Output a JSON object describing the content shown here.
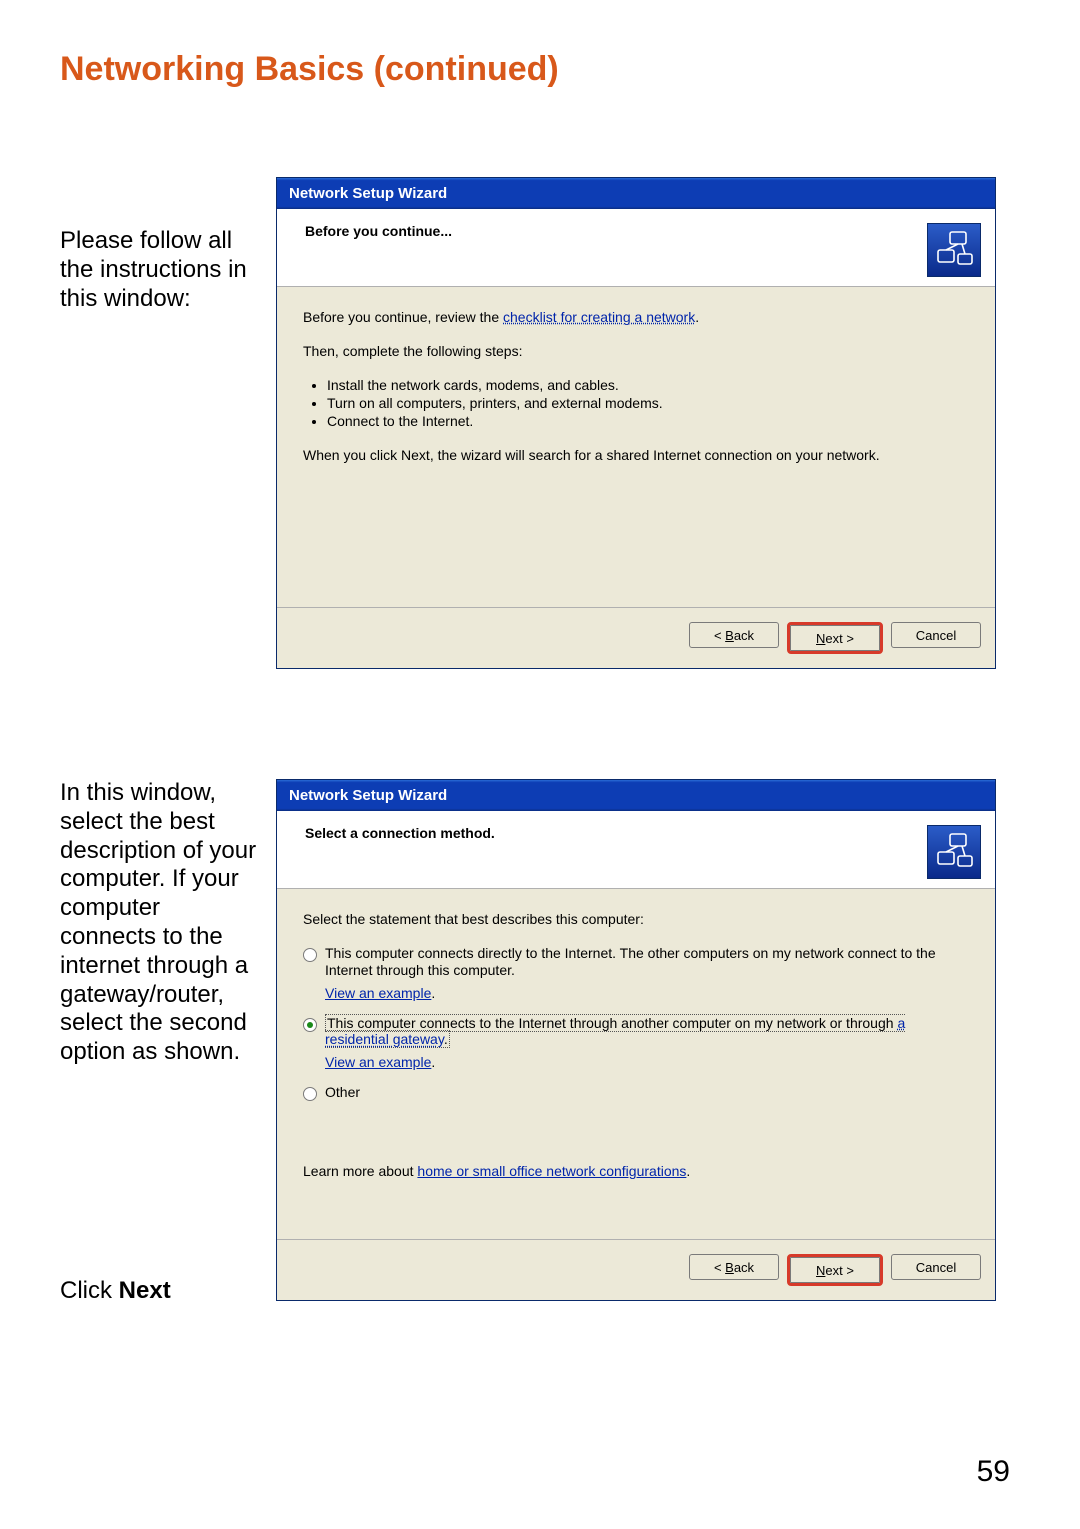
{
  "page_title": "Networking Basics (continued)",
  "page_number": "59",
  "section1": {
    "side_text": "Please follow all the instructions in this window:",
    "dlg_title": "Network Setup Wizard",
    "header": "Before you continue...",
    "body_intro_prefix": "Before you continue, review the ",
    "body_intro_link": "checklist for creating a network",
    "body_intro_suffix": ".",
    "body_then": "Then, complete the following steps:",
    "bullets": [
      "Install the network cards, modems, and cables.",
      "Turn on all computers, printers, and external modems.",
      "Connect to the Internet."
    ],
    "body_after": "When you click Next, the wizard will search for a shared Internet connection on your network.",
    "btn_back": "< Back",
    "btn_next": "Next >",
    "btn_cancel": "Cancel"
  },
  "section2": {
    "side_text": "In this window, select the best description of your computer. If your computer connects to the internet through a gateway/router, select the second option as shown.",
    "click_next_prefix": "Click ",
    "click_next_bold": "Next",
    "dlg_title": "Network Setup Wizard",
    "header": "Select a connection method.",
    "body_select": "Select the statement that best describes this computer:",
    "opt1_text": "This computer connects directly to the Internet. The other computers on my network connect to the Internet through this computer.",
    "opt2_text_a": "This computer connects to the Internet through another computer on my network or through ",
    "opt2_text_link": "a residential gateway",
    "opt2_text_b": ".",
    "opt3_text": "Other",
    "view_example": "View an example",
    "learn_more_prefix": "Learn more about ",
    "learn_more_link": "home or small office network configurations",
    "learn_more_suffix": ".",
    "btn_back": "< Back",
    "btn_next": "Next >",
    "btn_cancel": "Cancel"
  }
}
